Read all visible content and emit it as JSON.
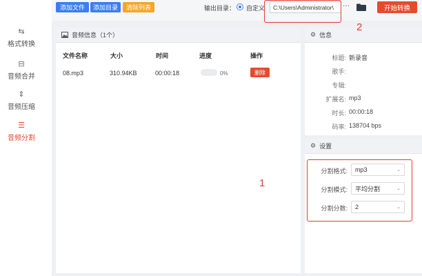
{
  "sidebar": {
    "items": [
      {
        "label": "格式转换",
        "icon": "convert-icon",
        "glyph": "⇆"
      },
      {
        "label": "音频合并",
        "icon": "merge-icon",
        "glyph": "⊟"
      },
      {
        "label": "音频压缩",
        "icon": "compress-icon",
        "glyph": "⇕"
      },
      {
        "label": "音频分割",
        "icon": "split-icon",
        "glyph": "☰",
        "active": true
      }
    ]
  },
  "toolbar": {
    "add_file": "添加文件",
    "add_folder": "添加目录",
    "clear_list": "清除列表",
    "output_label": "输出目录：",
    "custom_label": "自定义",
    "output_path": "C:\\Users\\Administrator\\",
    "browse": "···",
    "start": "开始转换"
  },
  "audio_panel": {
    "title": "音频信息（1个）",
    "columns": [
      "文件名称",
      "大小",
      "时间",
      "进度",
      "操作"
    ],
    "rows": [
      {
        "name": "08.mp3",
        "size": "310.94KB",
        "time": "00:00:18",
        "progress": "0%",
        "progress_value": 0,
        "action": "删除"
      }
    ]
  },
  "info_panel": {
    "title": "信息",
    "fields": [
      {
        "key": "标题:",
        "value": "新录音"
      },
      {
        "key": "歌手:",
        "value": ""
      },
      {
        "key": "专辑:",
        "value": ""
      },
      {
        "key": "扩展名:",
        "value": "mp3"
      },
      {
        "key": "时长:",
        "value": "00:00:18"
      },
      {
        "key": "码率:",
        "value": "138704 bps"
      }
    ]
  },
  "settings_panel": {
    "title": "设置",
    "fields": [
      {
        "label": "分割格式:",
        "value": "mp3"
      },
      {
        "label": "分割模式:",
        "value": "平均分割"
      },
      {
        "label": "分割分数:",
        "value": "2"
      }
    ]
  },
  "annotations": {
    "box1_number": "1",
    "box2_number": "2"
  },
  "colors": {
    "accent_red": "#e64a2e",
    "button_blue": "#3c7df0",
    "button_orange": "#f5a623",
    "annotation_red": "#e53935"
  }
}
